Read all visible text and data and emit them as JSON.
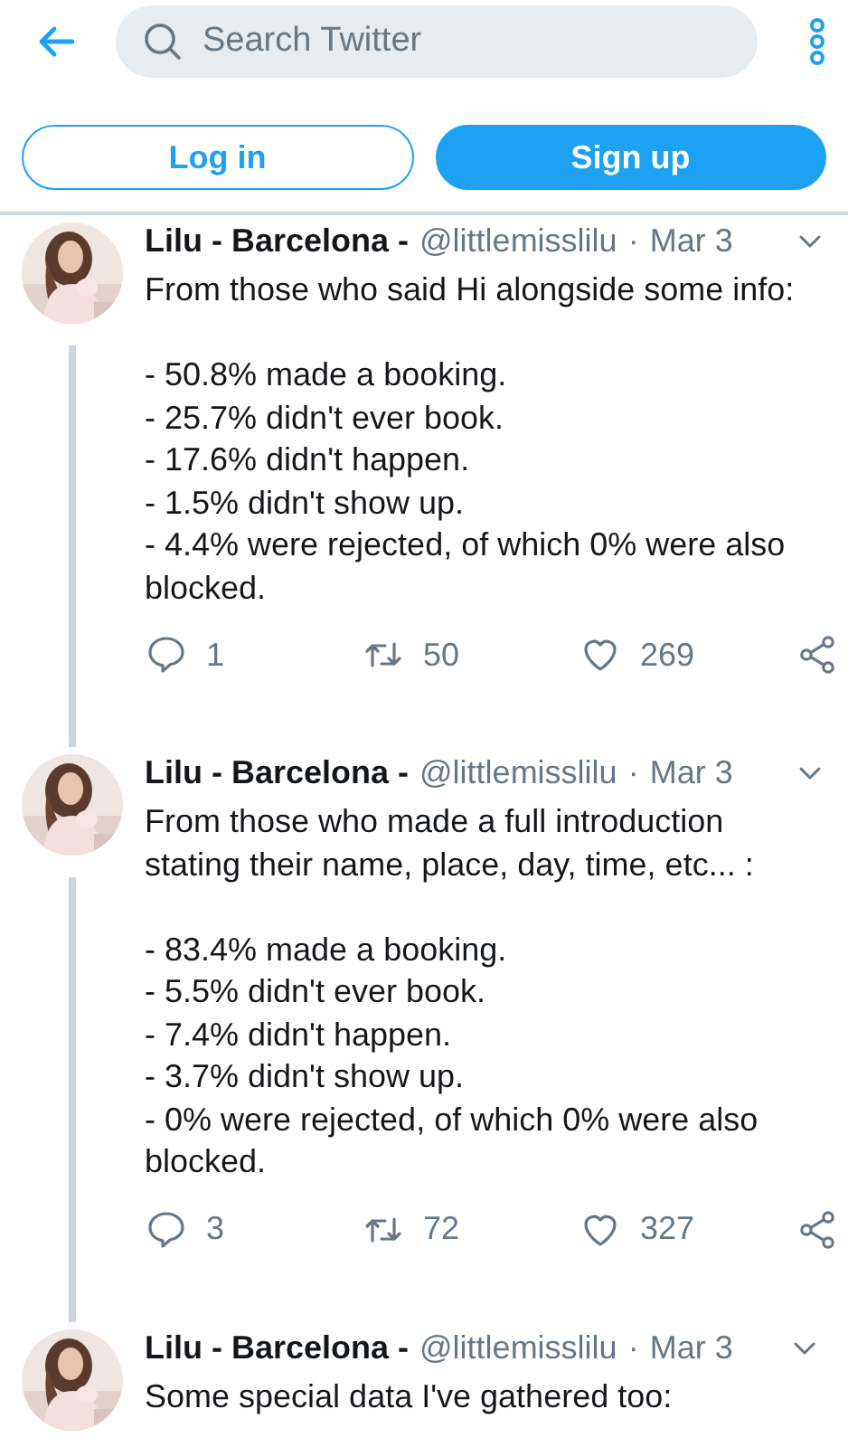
{
  "header": {
    "search": {
      "placeholder": "Search Twitter"
    }
  },
  "auth_buttons": [
    {
      "label": "Log in",
      "kind": "outline"
    },
    {
      "label": "Sign up",
      "kind": "filled"
    }
  ],
  "tweets": [
    {
      "author": "Lilu - Barcelona -",
      "handle": "@littlemisslilu",
      "separator": "·",
      "date": "Mar 3",
      "text": "From those who said Hi alongside some info:\n\n- 50.8% made a booking.\n- 25.7% didn't ever book.\n- 17.6% didn't happen.\n- 1.5% didn't show up.\n- 4.4% were rejected, of which 0% were also blocked.",
      "actions": [
        {
          "kind": "reply",
          "count": "1"
        },
        {
          "kind": "retweet",
          "count": "50"
        },
        {
          "kind": "like",
          "count": "269"
        },
        {
          "kind": "share"
        }
      ]
    },
    {
      "author": "Lilu - Barcelona -",
      "handle": "@littlemisslilu",
      "separator": "·",
      "date": "Mar 3",
      "text": "From those who made a full introduction stating their name, place, day, time, etc... :\n\n- 83.4% made a booking.\n- 5.5% didn't ever book.\n- 7.4% didn't happen.\n- 3.7% didn't show up.\n- 0% were rejected, of which 0% were also blocked.",
      "actions": [
        {
          "kind": "reply",
          "count": "3"
        },
        {
          "kind": "retweet",
          "count": "72"
        },
        {
          "kind": "like",
          "count": "327"
        },
        {
          "kind": "share"
        }
      ]
    },
    {
      "author": "Lilu - Barcelona -",
      "handle": "@littlemisslilu",
      "separator": "·",
      "date": "Mar 3",
      "text": "Some special data I've gathered too:"
    }
  ]
}
